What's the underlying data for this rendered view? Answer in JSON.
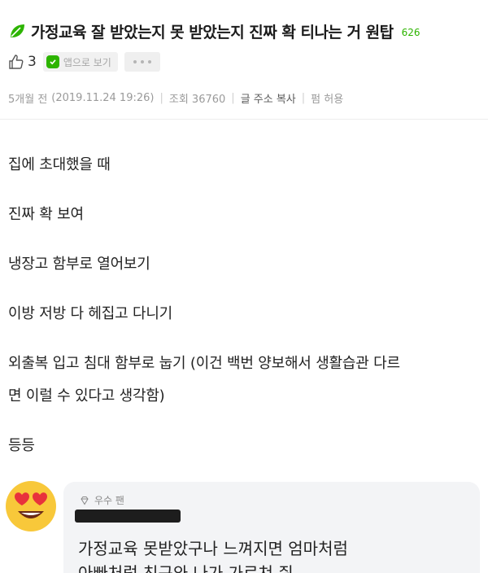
{
  "post": {
    "title": "가정교육 잘 받았는지 못 받았는지 진짜 확 티나는 거 원탑",
    "comment_count": "626",
    "leaf_icon": "leaf-icon",
    "leaf_color": "#2db400"
  },
  "actions": {
    "like_count": "3",
    "app_view_label": "앱으로 보기",
    "more_icon": "more-dots-icon"
  },
  "meta": {
    "relative_time": "5개월 전",
    "datetime": "(2019.11.24 19:26)",
    "views": "조회 36760",
    "copy_url": "글 주소 복사",
    "share_permission": "펌 허용"
  },
  "body": {
    "lines": [
      "집에 초대했을 때",
      "진짜 확 보여",
      "냉장고 함부로 열어보기",
      "이방 저방 다 헤집고 다니기",
      "외출복 입고 침대 함부로 눕기 (이건 백번 양보해서 생활습관 다르",
      "면 이럴 수 있다고 생각함)",
      "등등"
    ]
  },
  "comment": {
    "badge": "우수 팬",
    "avatar_icon": "heart-eyes-emoji-icon",
    "lines": [
      "가정교육 못받았구나 느껴지면 엄마처럼",
      "아빠처럼 친구와 나가 가르쳐 줘"
    ]
  },
  "colors": {
    "accent_green": "#2db400",
    "meta_gray": "#9a9a9a",
    "comment_bg": "#f3f4f6"
  }
}
